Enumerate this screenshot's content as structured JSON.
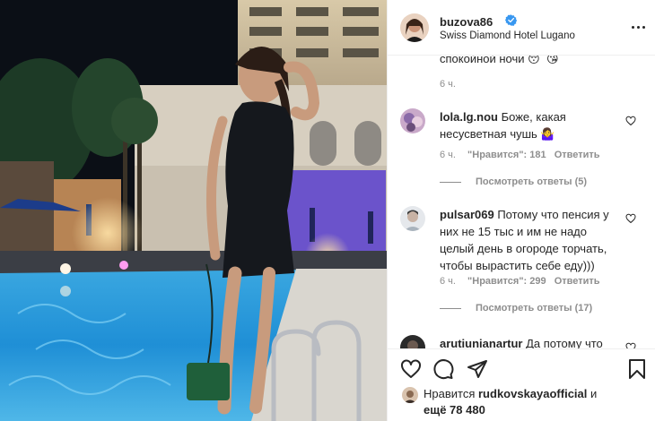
{
  "post": {
    "username": "buzova86",
    "location": "Swiss Diamond Hotel Lugano"
  },
  "comments": [
    {
      "text": "спокойной ночи 😴😘",
      "time": "6 ч."
    },
    {
      "username": "lola.lg.nou",
      "text_line1": "Боже, какая",
      "text_line2": "несусветная чушь 🤷‍♀️",
      "time": "6 ч.",
      "likes": "\"Нравится\": 181",
      "reply": "Ответить",
      "replies": "Посмотреть ответы (5)"
    },
    {
      "username": "pulsar069",
      "text_line1": "Потому что пенсия у",
      "text_line2": "них не 15 тыс и им не надо",
      "text_line3": "целый день в огороде торчать,",
      "text_line4": "чтобы вырастить себе еду)))",
      "time": "6 ч.",
      "likes": "\"Нравится\": 299",
      "reply": "Ответить",
      "replies": "Посмотреть ответы (17)"
    },
    {
      "username": "arutiunianartur",
      "text": "Да потому что"
    }
  ],
  "likes": {
    "prefix": "Нравится",
    "user": "rudkovskayaofficial",
    "and": "и",
    "more": "ещё 78 480"
  },
  "icons": {
    "verified": "verified-badge-icon",
    "more": "more-options-icon",
    "like": "heart-icon",
    "comment": "comment-icon",
    "share": "paper-plane-icon",
    "save": "bookmark-icon"
  },
  "colors": {
    "verified_blue": "#3897f0",
    "text": "#262626",
    "secondary": "#8e8e8e",
    "divider": "#efefef"
  }
}
